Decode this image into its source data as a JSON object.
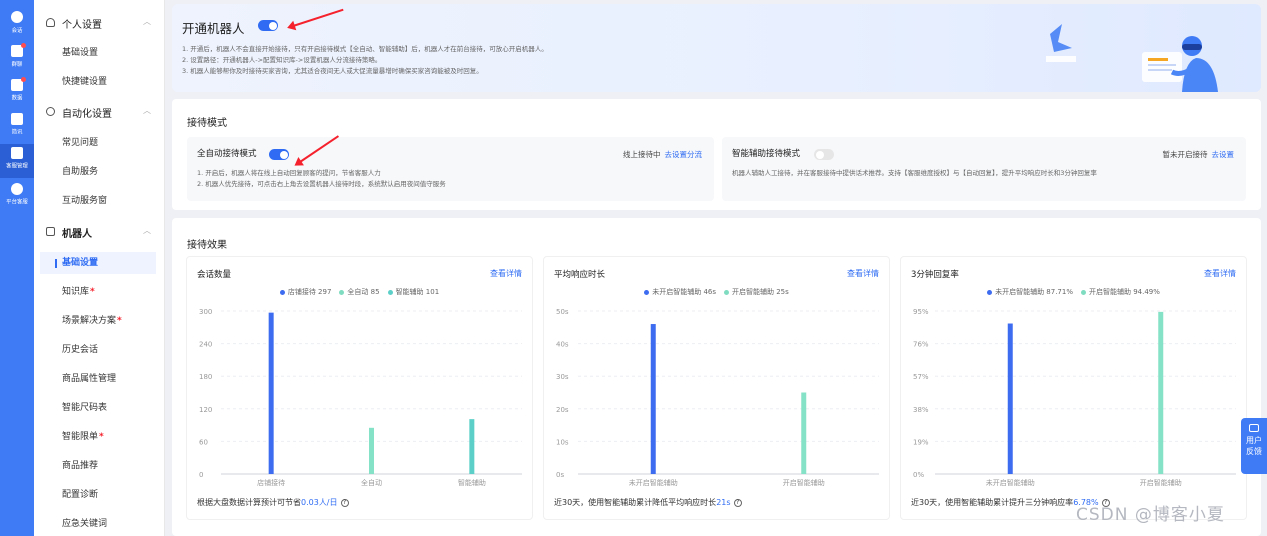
{
  "rail": [
    {
      "label": "会话",
      "icon": "chat-icon",
      "dot": false
    },
    {
      "label": "群聊",
      "icon": "group-icon",
      "dot": true
    },
    {
      "label": "数据",
      "icon": "data-icon",
      "dot": true
    },
    {
      "label": "简讯",
      "icon": "mail-icon",
      "dot": false
    },
    {
      "label": "客服管理",
      "icon": "grid-icon",
      "dot": false
    },
    {
      "label": "平台客服",
      "icon": "support-icon",
      "dot": false
    }
  ],
  "sidebar": {
    "personal": {
      "title": "个人设置",
      "items": [
        "基础设置",
        "快捷键设置"
      ]
    },
    "automation": {
      "title": "自动化设置",
      "items": [
        "常见问题",
        "自助服务",
        "互动服务窗"
      ]
    },
    "robot": {
      "title": "机器人",
      "items": [
        {
          "label": "基础设置",
          "req": "",
          "active": true
        },
        {
          "label": "知识库",
          "req": "*",
          "active": false
        },
        {
          "label": "场景解决方案",
          "req": "*",
          "active": false
        },
        {
          "label": "历史会话",
          "req": "",
          "active": false
        },
        {
          "label": "商品属性管理",
          "req": "",
          "active": false
        },
        {
          "label": "智能尺码表",
          "req": "",
          "active": false
        },
        {
          "label": "智能限单",
          "req": "*",
          "active": false
        },
        {
          "label": "商品推荐",
          "req": "",
          "active": false
        },
        {
          "label": "配置诊断",
          "req": "",
          "active": false
        },
        {
          "label": "应急关键词",
          "req": "",
          "active": false
        }
      ]
    }
  },
  "banner": {
    "title": "开通机器人",
    "enabled": true,
    "lines": [
      "1. 开通后，机器人不会直接开始接待，只有开启接待模式【全自动、智能辅助】后，机器人才在前台接待，可放心开启机器人。",
      "2. 设置路径：开通机器人->配置知识库->设置机器人分流接待策略。",
      "3. 机器人能够帮你及时接待买家咨询，尤其适合夜间无人或大促流量暴增时确保买家咨询能被及时回复。"
    ]
  },
  "modes": {
    "title": "接待模式",
    "auto": {
      "title": "全自动接待模式",
      "enabled": true,
      "status": "线上接待中",
      "link": "去设置分流",
      "lines": [
        "1. 开启后，机器人将在线上自动回复顾客的提问，节省客服人力",
        "2. 机器人优先接待，可点击右上角去设置机器人接待时段，系统默认启用夜间值守服务"
      ]
    },
    "assist": {
      "title": "智能辅助接待模式",
      "enabled": false,
      "status": "暂未开启接待",
      "link": "去设置",
      "lines": [
        "机器人辅助人工接待，并在客服接待中提供话术推荐。支持【客服维度授权】与【自动回复】，提升平均响应时长和3分钟回复率"
      ]
    }
  },
  "effects": {
    "title": "接待效果",
    "more": "查看详情",
    "panels": [
      {
        "title": "会话数量",
        "legend": [
          {
            "text": "店铺接待 297",
            "color": "#3e6cf0"
          },
          {
            "text": "全自动 85",
            "color": "#7fdcc0"
          },
          {
            "text": "智能辅助 101",
            "color": "#5cd0c8"
          }
        ],
        "foot_pre": "根据大盘数据计算预计可节省",
        "foot_hl": "0.03人/日",
        "foot_post": ""
      },
      {
        "title": "平均响应时长",
        "legend": [
          {
            "text": "未开启智能辅助 46s",
            "color": "#3e6cf0"
          },
          {
            "text": "开启智能辅助 25s",
            "color": "#7fdcc0"
          }
        ],
        "foot_pre": "近30天，使用智能辅助累计降低平均响应时长",
        "foot_hl": "21s",
        "foot_post": ""
      },
      {
        "title": "3分钟回复率",
        "legend": [
          {
            "text": "未开启智能辅助 87.71%",
            "color": "#3e6cf0"
          },
          {
            "text": "开启智能辅助 94.49%",
            "color": "#7fdcc0"
          }
        ],
        "foot_pre": "近30天，使用智能辅助累计提升三分钟响应率",
        "foot_hl": "6.78%",
        "foot_post": ""
      }
    ]
  },
  "chart_data": [
    {
      "type": "bar",
      "categories": [
        "店铺接待",
        "全自动",
        "智能辅助"
      ],
      "values": [
        297,
        85,
        101
      ],
      "yticks": [
        "300",
        "240",
        "180",
        "120",
        "60",
        "0"
      ],
      "ylim": [
        0,
        300
      ],
      "colors": [
        "#3e6cf0",
        "#86e2c6",
        "#5cd0c8"
      ],
      "grid": true
    },
    {
      "type": "bar",
      "categories": [
        "未开启智能辅助",
        "开启智能辅助"
      ],
      "values": [
        46,
        25
      ],
      "yticks": [
        "50s",
        "40s",
        "30s",
        "20s",
        "10s",
        "0s"
      ],
      "ylim": [
        0,
        50
      ],
      "colors": [
        "#3e6cf0",
        "#86e2c6"
      ],
      "grid": true
    },
    {
      "type": "bar",
      "categories": [
        "未开启智能辅助",
        "开启智能辅助"
      ],
      "values": [
        87.71,
        94.49
      ],
      "yticks": [
        "95%",
        "76%",
        "57%",
        "38%",
        "19%",
        "0%"
      ],
      "ylim": [
        0,
        95
      ],
      "colors": [
        "#3e6cf0",
        "#86e2c6"
      ],
      "grid": true
    }
  ],
  "feedback": "用户反馈",
  "watermark": "CSDN @博客小夏"
}
